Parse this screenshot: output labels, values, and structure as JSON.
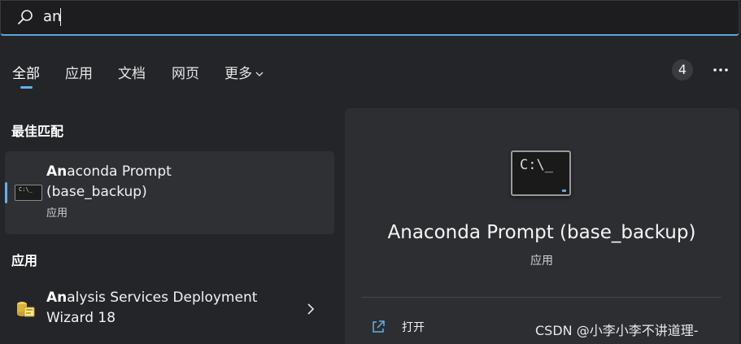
{
  "search": {
    "query": "an"
  },
  "tabs": [
    {
      "label": "全部",
      "active": true
    },
    {
      "label": "应用"
    },
    {
      "label": "文档"
    },
    {
      "label": "网页"
    },
    {
      "label": "更多"
    }
  ],
  "result_count": "4",
  "sections": {
    "best_match": "最佳匹配",
    "apps": "应用"
  },
  "best_match": {
    "title_bold": "An",
    "title_rest": "aconda Prompt",
    "title_line2": "(base_backup)",
    "subtitle": "应用",
    "icon": "command-prompt-icon",
    "icon_text": "C:\\_"
  },
  "apps": [
    {
      "title_bold": "An",
      "title_rest": "alysis Services Deployment",
      "title_line2": "Wizard 18",
      "icon": "analysis-services-icon"
    }
  ],
  "detail": {
    "title": "Anaconda Prompt (base_backup)",
    "subtitle": "应用",
    "icon_text": "C:\\_",
    "actions": [
      {
        "label": "打开",
        "icon": "open-external-icon"
      }
    ]
  },
  "watermark": "CSDN @小李小李不讲道理-",
  "colors": {
    "accent": "#5fb2ee",
    "background": "#232528",
    "card": "#2f3033"
  }
}
